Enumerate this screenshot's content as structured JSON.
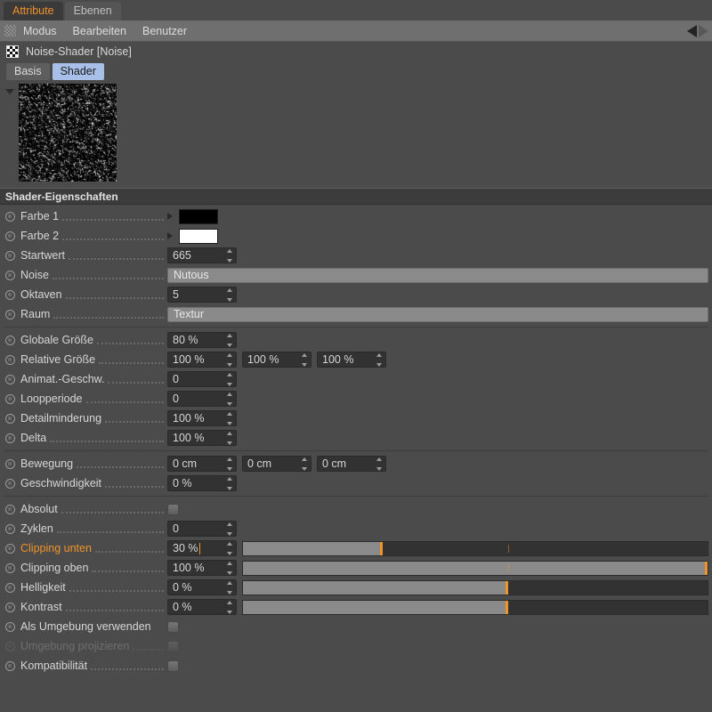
{
  "tabs": [
    {
      "label": "Attribute",
      "active": true
    },
    {
      "label": "Ebenen",
      "active": false
    }
  ],
  "menubar": {
    "grip_icon": "grip-icon",
    "items": [
      "Modus",
      "Bearbeiten",
      "Benutzer"
    ],
    "nav_back_icon": "nav-back-arrow-icon",
    "nav_forward_icon": "nav-forward-arrow-icon"
  },
  "object": {
    "icon": "checker-shader-icon",
    "name": "Noise-Shader [Noise]"
  },
  "subtabs": [
    {
      "label": "Basis",
      "active": false
    },
    {
      "label": "Shader",
      "active": true
    }
  ],
  "preview": {
    "name": "shader-preview-thumbnail",
    "disclosure_icon": "disclosure-triangle-icon"
  },
  "section": {
    "title": "Shader-Eigenschaften"
  },
  "accent_color": "#f0932b",
  "rows": [
    {
      "label": "Farbe 1",
      "type": "color",
      "value": "#000000"
    },
    {
      "label": "Farbe 2",
      "type": "color",
      "value": "#ffffff"
    },
    {
      "label": "Startwert",
      "type": "num",
      "value": "665"
    },
    {
      "label": "Noise",
      "type": "combo",
      "value": "Nutous"
    },
    {
      "label": "Oktaven",
      "type": "num",
      "value": "5"
    },
    {
      "label": "Raum",
      "type": "combo",
      "value": "Textur"
    },
    {
      "sep": true
    },
    {
      "label": "Globale Größe",
      "type": "num",
      "value": "80 %"
    },
    {
      "label": "Relative Größe",
      "type": "num3",
      "value": [
        "100 %",
        "100 %",
        "100 %"
      ]
    },
    {
      "label": "Animat.-Geschw.",
      "type": "num",
      "value": "0"
    },
    {
      "label": "Loopperiode",
      "type": "num",
      "value": "0"
    },
    {
      "label": "Detailminderung",
      "type": "num",
      "value": "100 %"
    },
    {
      "label": "Delta",
      "type": "num",
      "value": "100 %"
    },
    {
      "sep": true
    },
    {
      "label": "Bewegung",
      "type": "num3",
      "value": [
        "0 cm",
        "0 cm",
        "0 cm"
      ]
    },
    {
      "label": "Geschwindigkeit",
      "type": "num",
      "value": "0 %"
    },
    {
      "sep": true
    },
    {
      "label": "Absolut",
      "type": "check",
      "value": false
    },
    {
      "label": "Zyklen",
      "type": "num",
      "value": "0"
    },
    {
      "label": "Clipping unten",
      "type": "slider",
      "value": "30 %",
      "fill": 30,
      "tick": 57,
      "highlight": true,
      "caret": true
    },
    {
      "label": "Clipping oben",
      "type": "slider",
      "value": "100 %",
      "fill": 100,
      "tick": 57
    },
    {
      "label": "Helligkeit",
      "type": "slider",
      "value": "0 %",
      "fill": 57,
      "tick": null
    },
    {
      "label": "Kontrast",
      "type": "slider",
      "value": "0 %",
      "fill": 57,
      "tick": null
    },
    {
      "label": "Als Umgebung verwenden",
      "type": "check",
      "value": false,
      "nodots": true
    },
    {
      "label": "Umgebung projizieren",
      "type": "check",
      "value": false,
      "disabled": true
    },
    {
      "label": "Kompatibilität",
      "type": "check",
      "value": false
    }
  ]
}
